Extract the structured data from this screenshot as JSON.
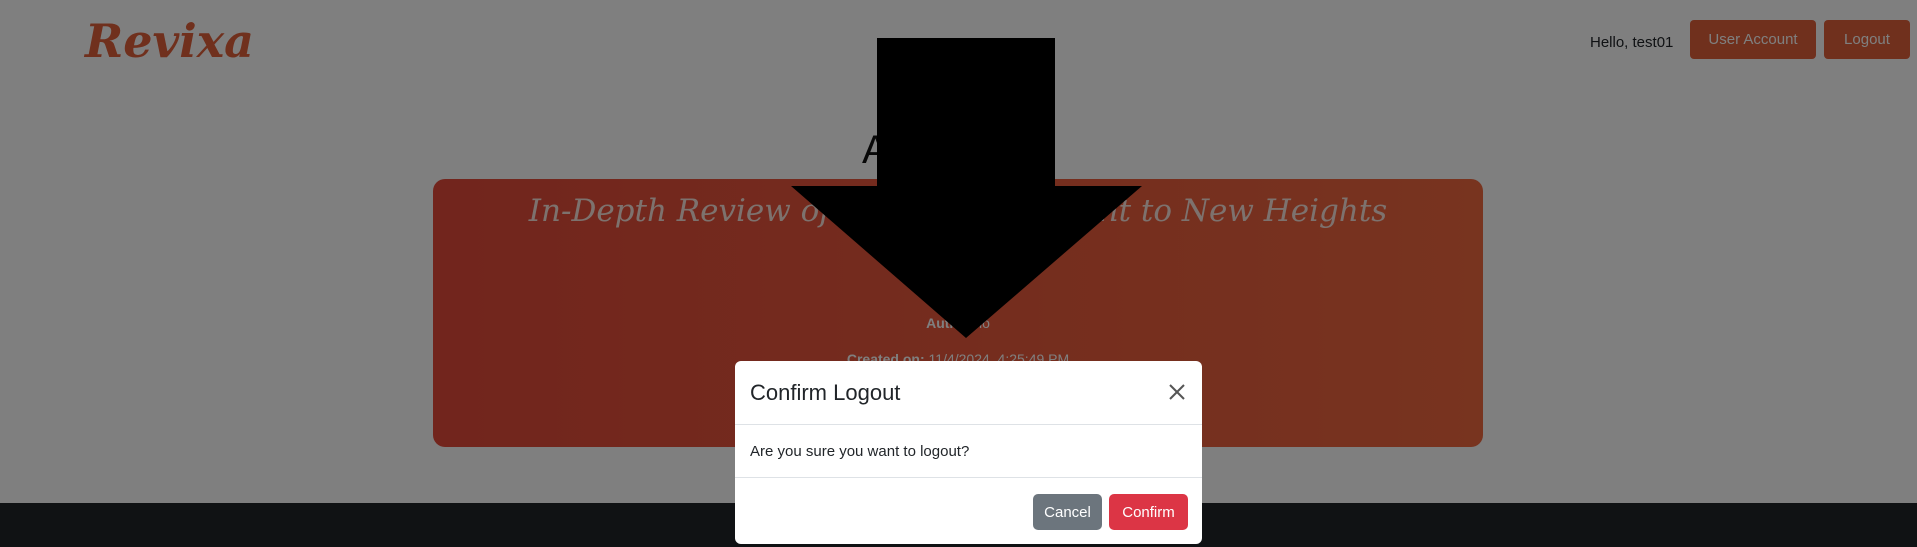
{
  "header": {
    "logo": "Revixa",
    "greeting": "Hello, test01",
    "user_account_label": "User Account",
    "logout_label": "Logout"
  },
  "main": {
    "heading": "A",
    "card": {
      "title": "In-Depth Review of React… …lopment to New Heights",
      "author_label": "Autho",
      "author_value": "ario",
      "created_label": "Created on:",
      "created_value": "11/4/2024, 4:25:49 PM"
    }
  },
  "modal": {
    "title": "Confirm Logout",
    "message": "Are you sure you want to logout?",
    "cancel_label": "Cancel",
    "confirm_label": "Confirm"
  },
  "colors": {
    "brand": "#e0603a",
    "danger": "#dc3545",
    "secondary": "#6c757d",
    "footer": "#212529"
  },
  "icons": {
    "close": "close-icon",
    "annotation": "down-arrow-icon"
  }
}
